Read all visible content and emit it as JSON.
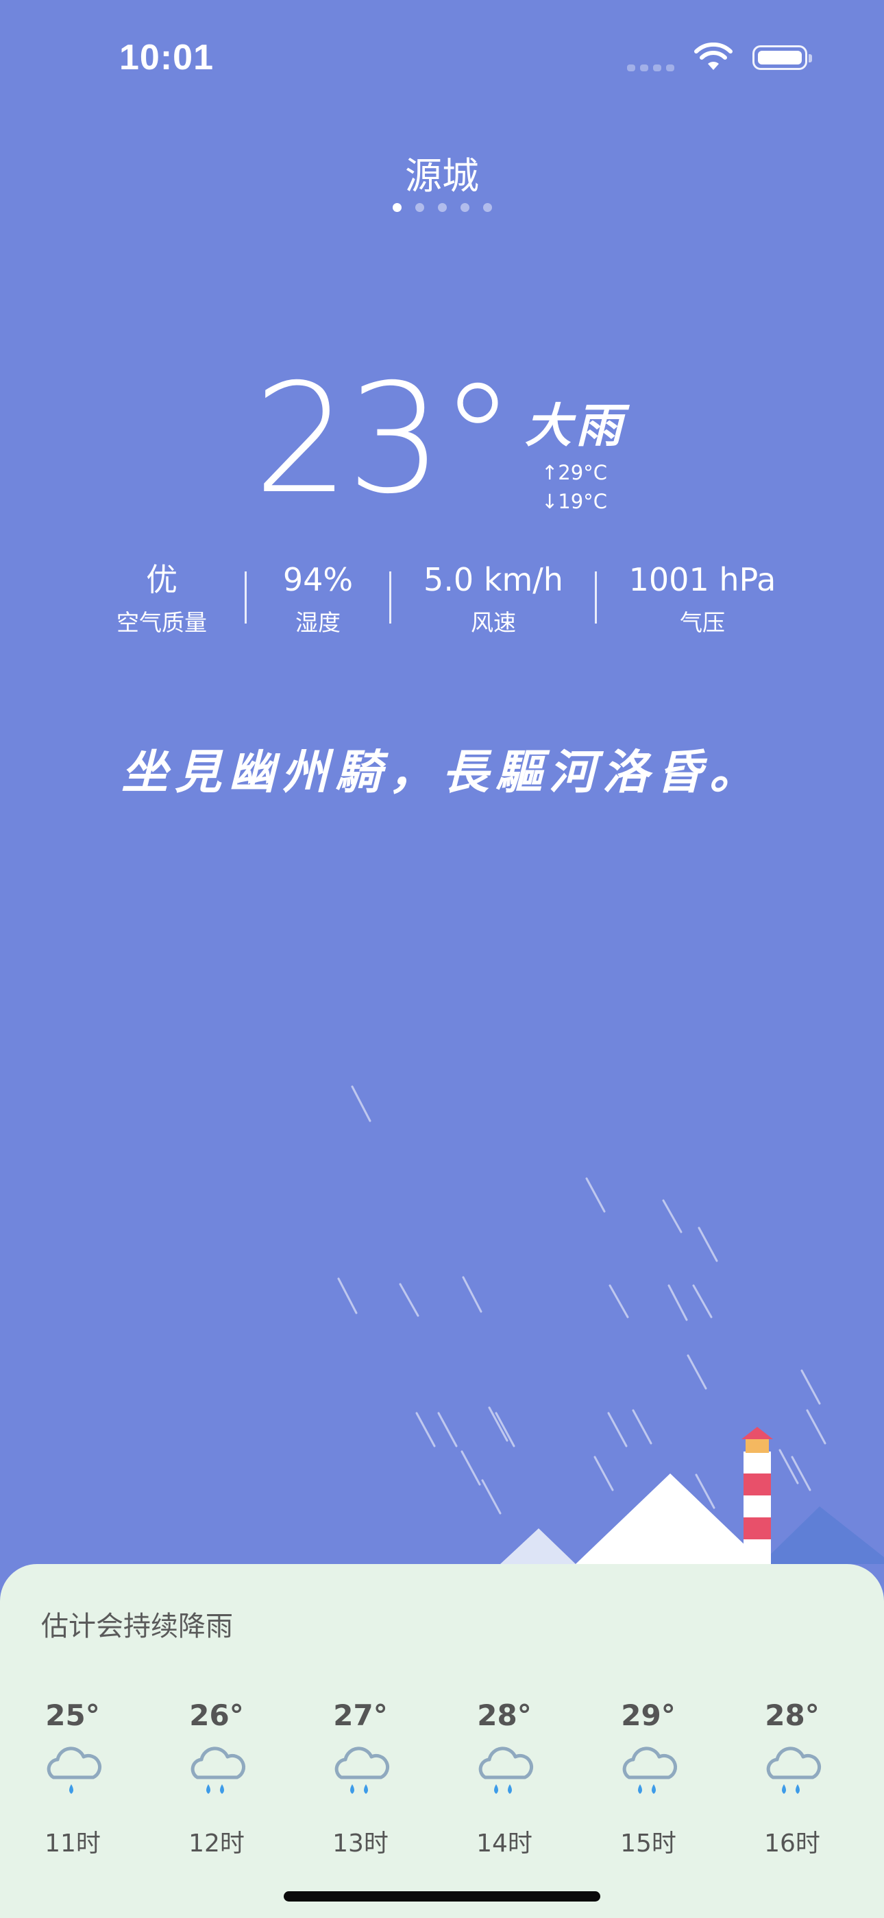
{
  "status_bar": {
    "time": "10:01"
  },
  "location": {
    "city": "源城",
    "pages": 5,
    "active_page": 0
  },
  "current": {
    "temperature": "23°",
    "condition": "大雨",
    "high": "↑29°C",
    "low": "↓19°C"
  },
  "stats": [
    {
      "value": "优",
      "label": "空气质量"
    },
    {
      "value": "94%",
      "label": "湿度"
    },
    {
      "value": "5.0 km/h",
      "label": "风速"
    },
    {
      "value": "1001 hPa",
      "label": "气压"
    }
  ],
  "poem": "坐見幽州騎，長驅河洛昏。",
  "forecast": {
    "title": "估计会持续降雨",
    "hours": [
      {
        "temp": "25°",
        "time": "11时",
        "icon": "rain-cloud-icon"
      },
      {
        "temp": "26°",
        "time": "12时",
        "icon": "rain-cloud-icon"
      },
      {
        "temp": "27°",
        "time": "13时",
        "icon": "rain-cloud-icon"
      },
      {
        "temp": "28°",
        "time": "14时",
        "icon": "rain-cloud-icon"
      },
      {
        "temp": "29°",
        "time": "15时",
        "icon": "rain-cloud-icon"
      },
      {
        "temp": "28°",
        "time": "16时",
        "icon": "rain-cloud-icon"
      }
    ]
  },
  "colors": {
    "background": "#7186dc",
    "panel": "#e6f3e8",
    "rain_drop": "#3d9be8",
    "cloud_outline": "#8fa9bf"
  }
}
